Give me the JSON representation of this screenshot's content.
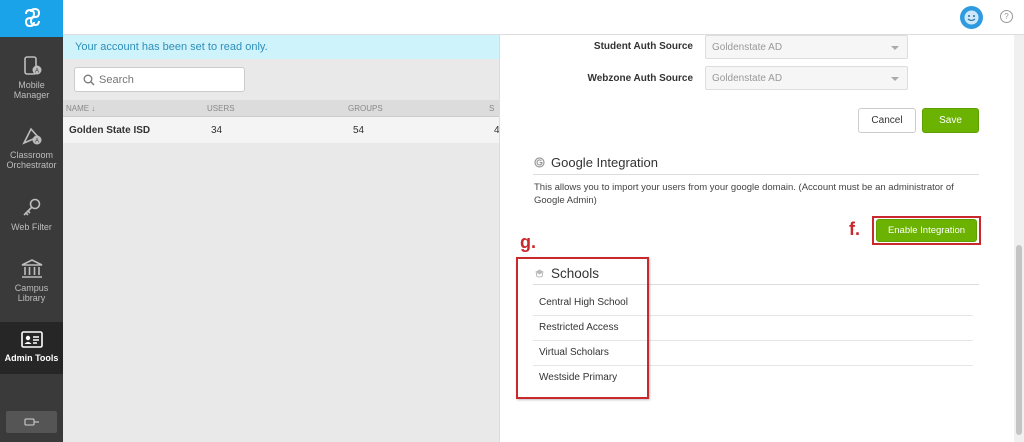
{
  "sidebar": {
    "items": [
      {
        "label": "Mobile Manager",
        "icon": "mobile-manager-icon"
      },
      {
        "label": "Classroom Orchestrator",
        "icon": "classroom-orchestrator-icon"
      },
      {
        "label": "Web Filter",
        "icon": "web-filter-icon"
      },
      {
        "label": "Campus Library",
        "icon": "campus-library-icon"
      },
      {
        "label": "Admin Tools",
        "icon": "admin-tools-icon"
      }
    ],
    "active": "Admin Tools"
  },
  "notice": "Your account has been set to read only.",
  "search": {
    "placeholder": "Search"
  },
  "table": {
    "headers": [
      "NAME ↓",
      "USERS",
      "GROUPS",
      "S"
    ],
    "rows": [
      {
        "name": "Golden State ISD",
        "users": "34",
        "groups": "54",
        "other": "4"
      }
    ]
  },
  "auth": {
    "student_label": "Student Auth Source",
    "student_value": "Goldenstate AD",
    "webzone_label": "Webzone Auth Source",
    "webzone_value": "Goldenstate AD"
  },
  "actions": {
    "cancel": "Cancel",
    "save": "Save"
  },
  "google": {
    "title": "Google Integration",
    "description": "This allows you to import your users from your google domain. (Account must be an administrator of Google Admin)",
    "enable": "Enable Integration"
  },
  "annotations": {
    "f": "f.",
    "g": "g."
  },
  "schools": {
    "title": "Schools",
    "items": [
      "Central High School",
      "Restricted Access",
      "Virtual Scholars",
      "Westside Primary"
    ]
  },
  "colors": {
    "accent": "#1aa3e8",
    "primary_button": "#6bb300",
    "annotation": "#c9282d"
  }
}
